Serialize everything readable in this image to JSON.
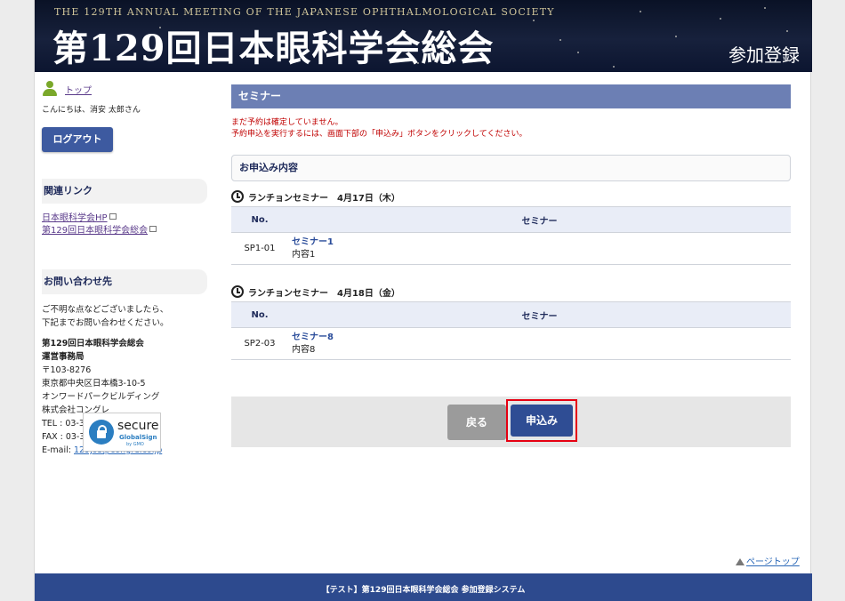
{
  "header": {
    "english_title": "THE 129TH ANNUAL MEETING OF THE JAPANESE OPHTHALMOLOGICAL SOCIETY",
    "japanese_title": "第129回日本眼科学会総会",
    "registration": "参加登録"
  },
  "sidebar": {
    "top_link": "トップ",
    "greeting": "こんにちは、消安 太郎さん",
    "logout": "ログアウト",
    "related_heading": "関連リンク",
    "related_links": [
      "日本眼科学会HP",
      "第129回日本眼科学会総会"
    ],
    "contact_heading": "お問い合わせ先",
    "contact_intro_1": "ご不明な点などございましたら、",
    "contact_intro_2": "下記までお問い合わせください。",
    "org_name": "第129回日本眼科学会総会",
    "office": "運営事務局",
    "postal": "〒103-8276",
    "address": "東京都中央区日本橋3-10-5",
    "building": "オンワードパークビルディング",
    "company": "株式会社コングレ",
    "tel": "TEL : 03-3510-3701",
    "fax": "FAX : 03-3510-3702",
    "email_label": "E-mail: ",
    "email": "129jos@congre.co.jp",
    "ssl_secure": "secure",
    "ssl_globalsign": "GlobalSign",
    "ssl_gmo": "by GMO"
  },
  "main": {
    "section_title": "セミナー",
    "notice_1": "まだ予約は確定していません。",
    "notice_2": "予約申込を実行するには、画面下部の「申込み」ボタンをクリックしてください。",
    "panel_title": "お申込み内容",
    "col_no": "No.",
    "col_seminar": "セミナー",
    "sessions": [
      {
        "title": "ランチョンセミナー　4月17日（木）",
        "no": "SP1-01",
        "name": "セミナー1",
        "content": "内容1"
      },
      {
        "title": "ランチョンセミナー　4月18日（金）",
        "no": "SP2-03",
        "name": "セミナー8",
        "content": "内容8"
      }
    ],
    "back_button": "戻る",
    "apply_button": "申込み"
  },
  "page_top": "ページトップ",
  "footer": "【テスト】第129回日本眼科学会総会 参加登録システム"
}
